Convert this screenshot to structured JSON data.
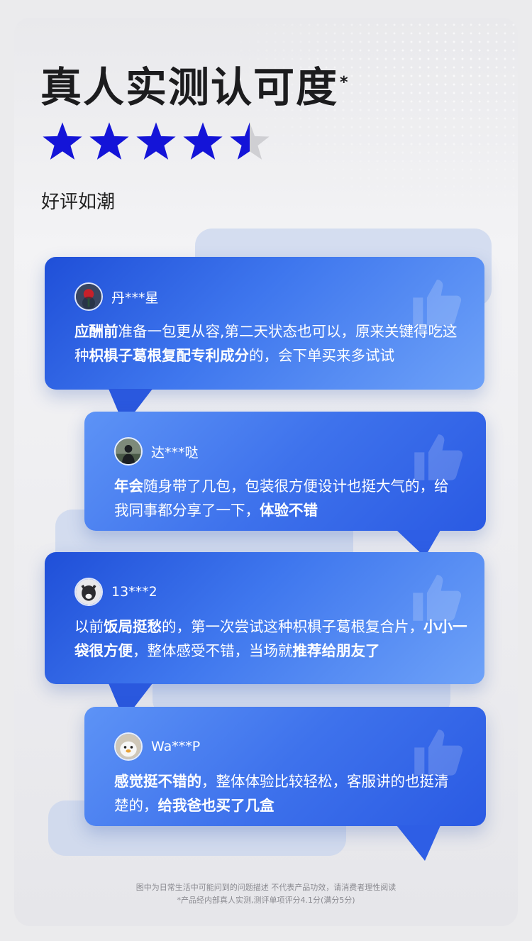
{
  "title": "真人实测认可度",
  "title_mark": "*",
  "rating": {
    "value": 4.5,
    "max": 5
  },
  "subtitle": "好评如潮",
  "colors": {
    "accent": "#1414d8",
    "bubble_dark": "#1f4fd8",
    "bubble_light": "#6ea2f8"
  },
  "reviews": [
    {
      "user": "丹***星",
      "avatar_icon": "rose-avatar",
      "segments": [
        {
          "text": "应酬前",
          "bold": true
        },
        {
          "text": "准备一包更从容,第二天状态也可以，原来关键得吃这种",
          "bold": false
        },
        {
          "text": "枳椇子葛根复配专利成分",
          "bold": true
        },
        {
          "text": "的，会下单买来多试试",
          "bold": false
        }
      ]
    },
    {
      "user": "达***哒",
      "avatar_icon": "silhouette-avatar",
      "segments": [
        {
          "text": "年会",
          "bold": true
        },
        {
          "text": "随身带了几包，包装很方便设计也挺大气的，给我同事都分享了一下，",
          "bold": false
        },
        {
          "text": "体验不错",
          "bold": true
        }
      ]
    },
    {
      "user": "13***2",
      "avatar_icon": "dog-avatar",
      "segments": [
        {
          "text": "以前",
          "bold": false
        },
        {
          "text": "饭局挺愁",
          "bold": true
        },
        {
          "text": "的，第一次尝试这种枳椇子葛根复合片，",
          "bold": false
        },
        {
          "text": "小小一袋很方便",
          "bold": true
        },
        {
          "text": "，整体感受不错，当场就",
          "bold": false
        },
        {
          "text": "推荐给朋友了",
          "bold": true
        }
      ]
    },
    {
      "user": "Wa***P",
      "avatar_icon": "penguin-avatar",
      "segments": [
        {
          "text": "感觉挺不错的",
          "bold": true
        },
        {
          "text": "，整体体验比较轻松，客服讲的也挺清楚的，",
          "bold": false
        },
        {
          "text": "给我爸也买了几盒",
          "bold": true
        }
      ]
    }
  ],
  "footer": {
    "line1": "图中为日常生活中可能问到的问题描述  不代表产品功效，请消费者理性阅读",
    "line2": "*产品经内部真人实测,测评单项评分4.1分(满分5分)"
  }
}
